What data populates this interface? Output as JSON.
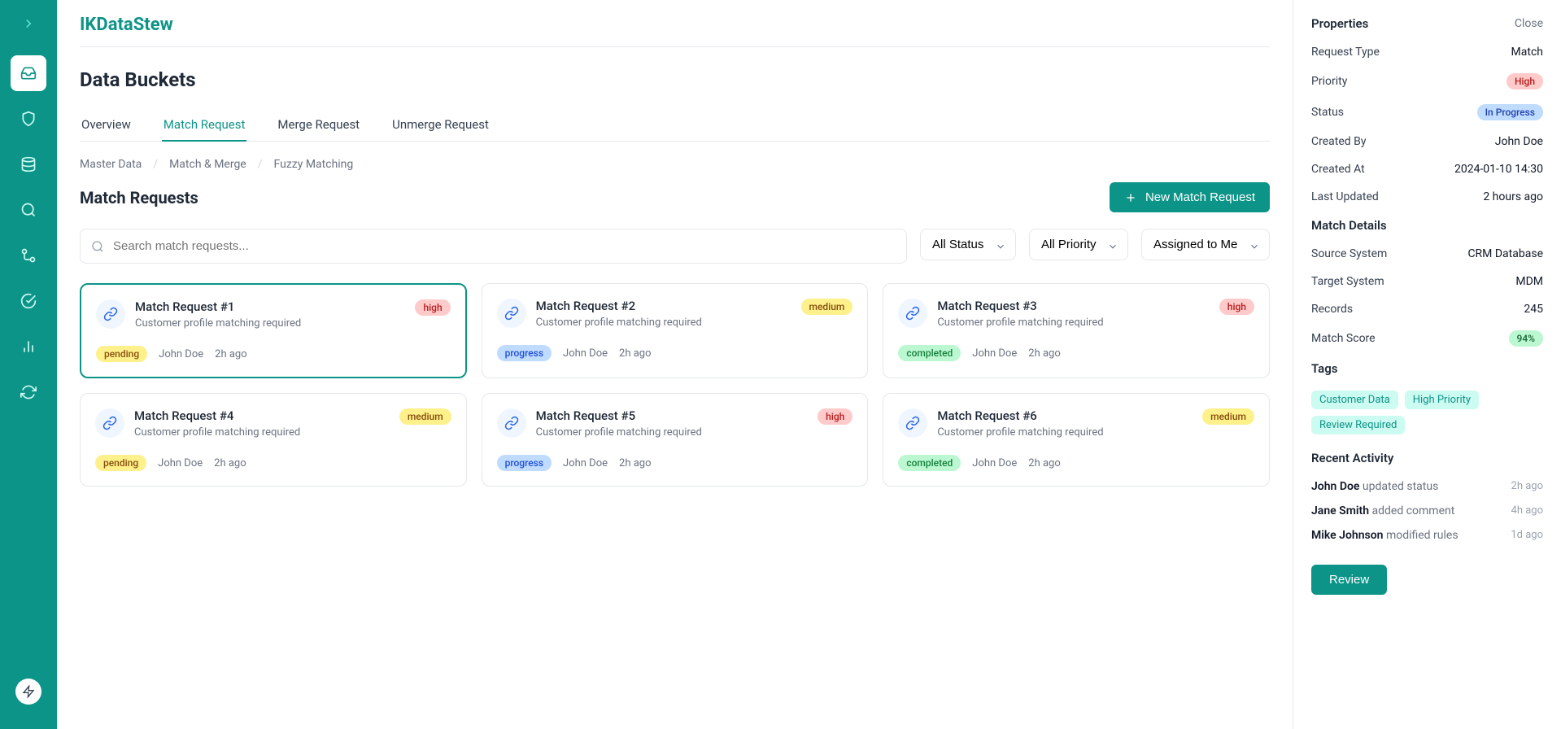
{
  "app": {
    "title": "IKDataStew"
  },
  "page": {
    "title": "Data Buckets"
  },
  "tabs": [
    "Overview",
    "Match Request",
    "Merge Request",
    "Unmerge Request"
  ],
  "breadcrumb": [
    "Master Data",
    "Match & Merge",
    "Fuzzy Matching"
  ],
  "subheader": {
    "title": "Match Requests",
    "new_btn": "New Match Request"
  },
  "search": {
    "placeholder": "Search match requests..."
  },
  "filters": {
    "status": "All Status",
    "priority": "All Priority",
    "assigned": "Assigned to Me"
  },
  "cards": [
    {
      "title": "Match Request #1",
      "desc": "Customer profile matching required",
      "priority": "high",
      "status": "pending",
      "author": "John Doe",
      "time": "2h ago",
      "selected": true
    },
    {
      "title": "Match Request #2",
      "desc": "Customer profile matching required",
      "priority": "medium",
      "status": "progress",
      "author": "John Doe",
      "time": "2h ago",
      "selected": false
    },
    {
      "title": "Match Request #3",
      "desc": "Customer profile matching required",
      "priority": "high",
      "status": "completed",
      "author": "John Doe",
      "time": "2h ago",
      "selected": false
    },
    {
      "title": "Match Request #4",
      "desc": "Customer profile matching required",
      "priority": "medium",
      "status": "pending",
      "author": "John Doe",
      "time": "2h ago",
      "selected": false
    },
    {
      "title": "Match Request #5",
      "desc": "Customer profile matching required",
      "priority": "high",
      "status": "progress",
      "author": "John Doe",
      "time": "2h ago",
      "selected": false
    },
    {
      "title": "Match Request #6",
      "desc": "Customer profile matching required",
      "priority": "medium",
      "status": "completed",
      "author": "John Doe",
      "time": "2h ago",
      "selected": false
    }
  ],
  "panel": {
    "title": "Properties",
    "close": "Close",
    "props": {
      "request_type": {
        "label": "Request Type",
        "value": "Match"
      },
      "priority": {
        "label": "Priority",
        "value": "High"
      },
      "status": {
        "label": "Status",
        "value": "In Progress"
      },
      "created_by": {
        "label": "Created By",
        "value": "John Doe"
      },
      "created_at": {
        "label": "Created At",
        "value": "2024-01-10 14:30"
      },
      "last_updated": {
        "label": "Last Updated",
        "value": "2 hours ago"
      }
    },
    "match_details_title": "Match Details",
    "details": {
      "source": {
        "label": "Source System",
        "value": "CRM Database"
      },
      "target": {
        "label": "Target System",
        "value": "MDM"
      },
      "records": {
        "label": "Records",
        "value": "245"
      },
      "score": {
        "label": "Match Score",
        "value": "94%"
      }
    },
    "tags_title": "Tags",
    "tags": [
      "Customer Data",
      "High Priority",
      "Review Required"
    ],
    "activity_title": "Recent Activity",
    "activity": [
      {
        "name": "John Doe",
        "action": "updated status",
        "time": "2h ago"
      },
      {
        "name": "Jane Smith",
        "action": "added comment",
        "time": "4h ago"
      },
      {
        "name": "Mike Johnson",
        "action": "modified rules",
        "time": "1d ago"
      }
    ],
    "review_btn": "Review"
  }
}
